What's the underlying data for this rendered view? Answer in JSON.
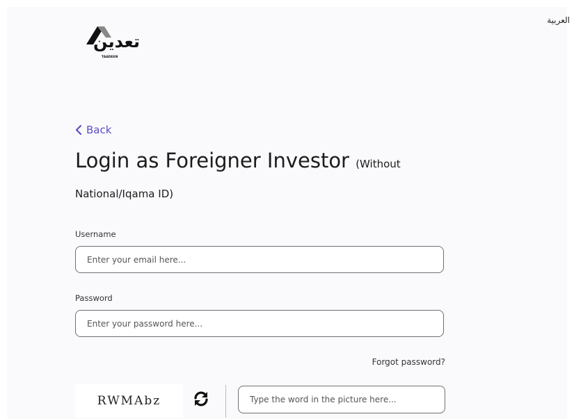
{
  "header": {
    "language_toggle": "العربية",
    "logo_arabic": "تعدين",
    "logo_latin": "TAADEEN"
  },
  "nav": {
    "back_label": "Back"
  },
  "login": {
    "title": "Login as Foreigner Investor",
    "title_suffix": "(Without",
    "subtitle": "National/Iqama ID)",
    "username_label": "Username",
    "username_placeholder": "Enter your email here...",
    "password_label": "Password",
    "password_placeholder": "Enter your password here...",
    "forgot_password": "Forgot password?",
    "captcha_text": "RWMAbz",
    "captcha_placeholder": "Type the word in the picture here..."
  },
  "colors": {
    "accent": "#5b4fc4",
    "border": "#6f6f6f",
    "text": "#1c1c1c"
  }
}
